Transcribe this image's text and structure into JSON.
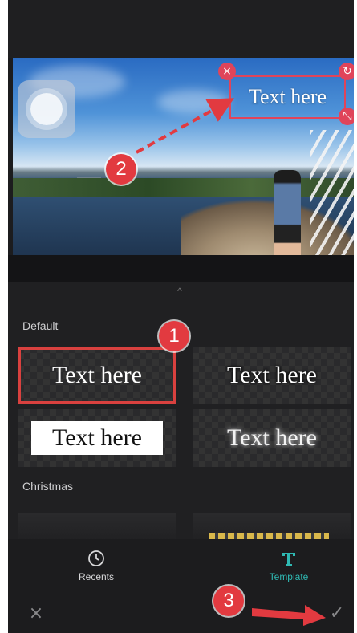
{
  "preview": {
    "overlay_text": "Text here",
    "close_glyph": "×",
    "rotate_glyph": "↻",
    "scale_glyph": "⤡"
  },
  "annotations": {
    "step1": "1",
    "step2": "2",
    "step3": "3",
    "color": "#e23a40"
  },
  "panel": {
    "collapse_glyph": "^",
    "sections": [
      {
        "title": "Default",
        "templates": [
          "Text here",
          "Text here",
          "Text here",
          "Text here"
        ]
      },
      {
        "title": "Christmas"
      }
    ]
  },
  "tabs": {
    "recents": "Recents",
    "template": "Template",
    "active_color": "#2fb9b3"
  },
  "actions": {
    "close_glyph": "×",
    "confirm_glyph": "✓"
  }
}
